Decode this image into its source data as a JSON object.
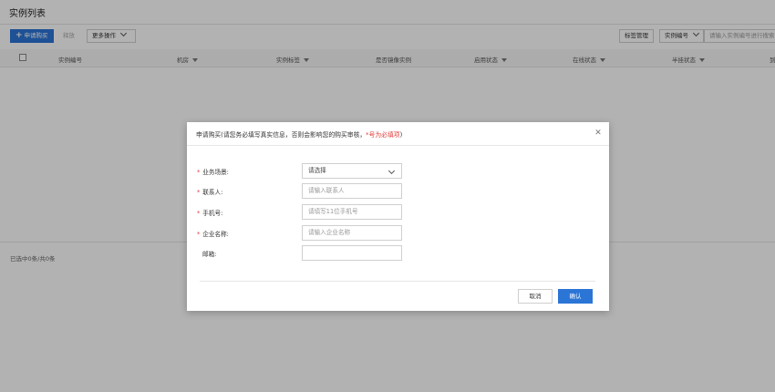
{
  "page": {
    "title": "实例列表"
  },
  "toolbar": {
    "apply_label": "申请购买",
    "release_label": "释放",
    "more_label": "更多操作",
    "tag_manage_label": "标签管理",
    "filter_field_label": "实例编号",
    "search_placeholder": "请输入实例编号进行搜索"
  },
  "table": {
    "columns": [
      "实例编号",
      "机房",
      "实例标签",
      "是否镜像实例",
      "启用状态",
      "在线状态",
      "半挂状态",
      "到"
    ]
  },
  "footer": {
    "selection_text": "已选中0条/共0条"
  },
  "dialog": {
    "title_main": "申请购买(请您务必填写真实信息，否则会影响您的购买审核，",
    "title_required": "*号为必填项",
    "title_end": ")",
    "close_symbol": "✕",
    "fields": [
      {
        "label": "业务场景:",
        "required": true,
        "type": "select",
        "value": "请选择"
      },
      {
        "label": "联系人:",
        "required": true,
        "type": "input",
        "placeholder": "请输入联系人"
      },
      {
        "label": "手机号:",
        "required": true,
        "type": "input",
        "placeholder": "请填写11位手机号"
      },
      {
        "label": "企业名称:",
        "required": true,
        "type": "input",
        "placeholder": "请输入企业名称"
      },
      {
        "label": "邮箱:",
        "required": false,
        "type": "input",
        "placeholder": ""
      }
    ],
    "cancel_label": "取消",
    "confirm_label": "确认"
  }
}
